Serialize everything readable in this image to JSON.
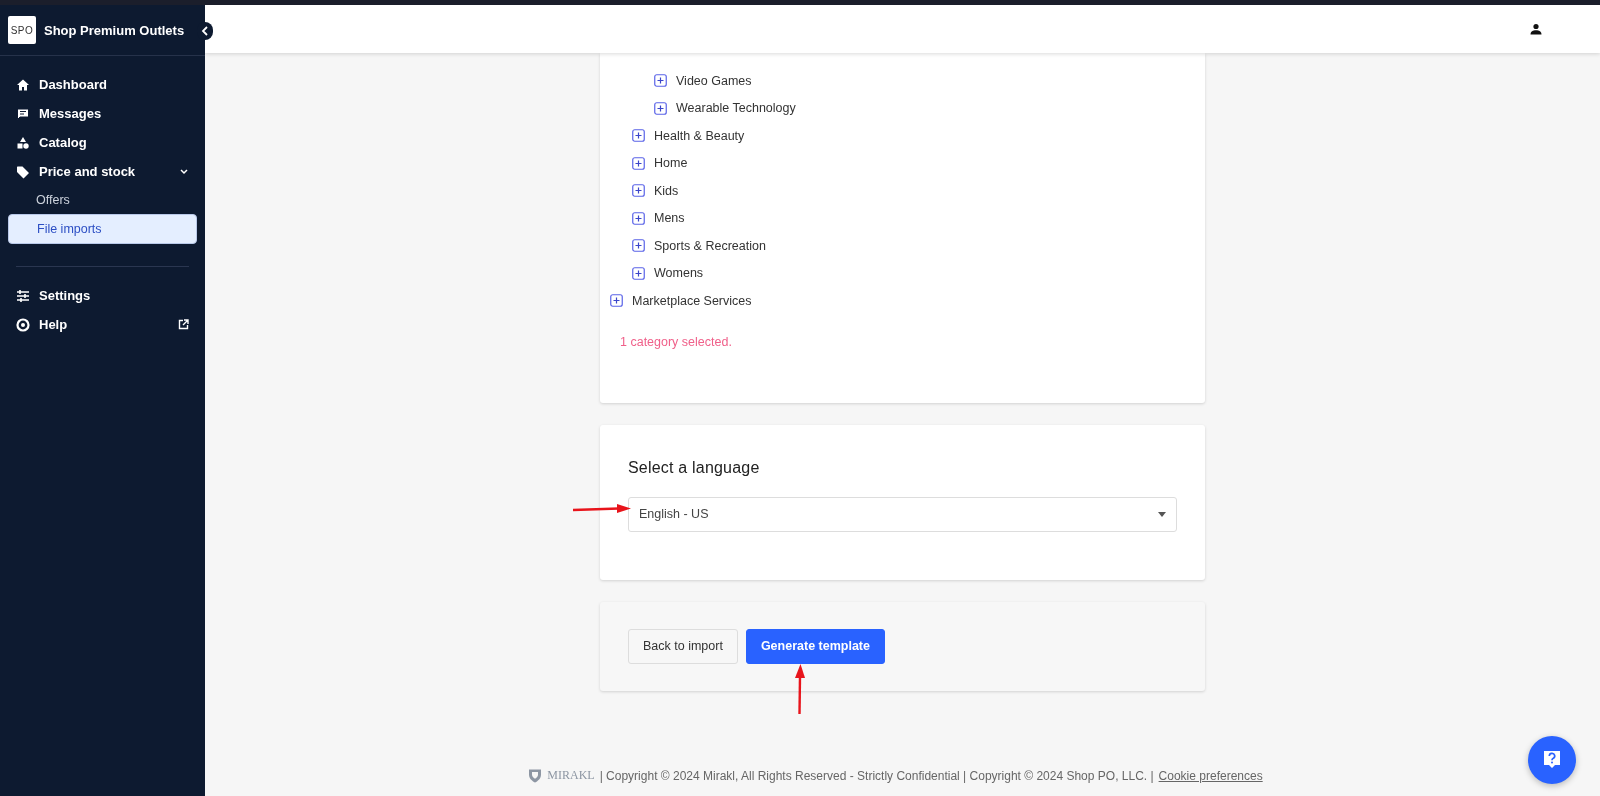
{
  "sidebar": {
    "brand": {
      "logo_text": "SPO",
      "name": "Shop Premium Outlets"
    },
    "items": [
      {
        "label": "Dashboard",
        "kind": "item",
        "selected": false
      },
      {
        "label": "Messages",
        "kind": "item",
        "selected": false
      },
      {
        "label": "Catalog",
        "kind": "item",
        "selected": false
      },
      {
        "label": "Price and stock",
        "kind": "group",
        "selected": false,
        "expanded": true,
        "children": [
          {
            "label": "Offers",
            "selected": false
          },
          {
            "label": "File imports",
            "selected": true
          }
        ]
      }
    ],
    "bottom_items": [
      {
        "label": "Settings",
        "kind": "item"
      },
      {
        "label": "Help",
        "kind": "external"
      }
    ]
  },
  "category_tree": {
    "nodes": [
      {
        "children": [
          {
            "children": [
              {
                "label": "Video Games"
              },
              {
                "label": "Wearable Technology"
              }
            ]
          },
          {
            "label": "Health & Beauty"
          },
          {
            "label": "Home"
          },
          {
            "label": "Kids"
          },
          {
            "label": "Mens"
          },
          {
            "label": "Sports & Recreation"
          },
          {
            "label": "Womens"
          }
        ]
      },
      {
        "label": "Marketplace Services"
      }
    ],
    "selection_note": "1 category selected."
  },
  "language": {
    "title": "Select a language",
    "value": "English - US"
  },
  "buttons": [
    {
      "label": "Back to import",
      "kind": "secondary"
    },
    {
      "label": "Generate template",
      "kind": "primary"
    }
  ],
  "footer": {
    "logo_text": "MIRAKL",
    "text": "| Copyright © 2024 Mirakl, All Rights Reserved - Strictly Confidential | Copyright © 2024 Shop PO, LLC.  |",
    "link": "Cookie preferences"
  }
}
